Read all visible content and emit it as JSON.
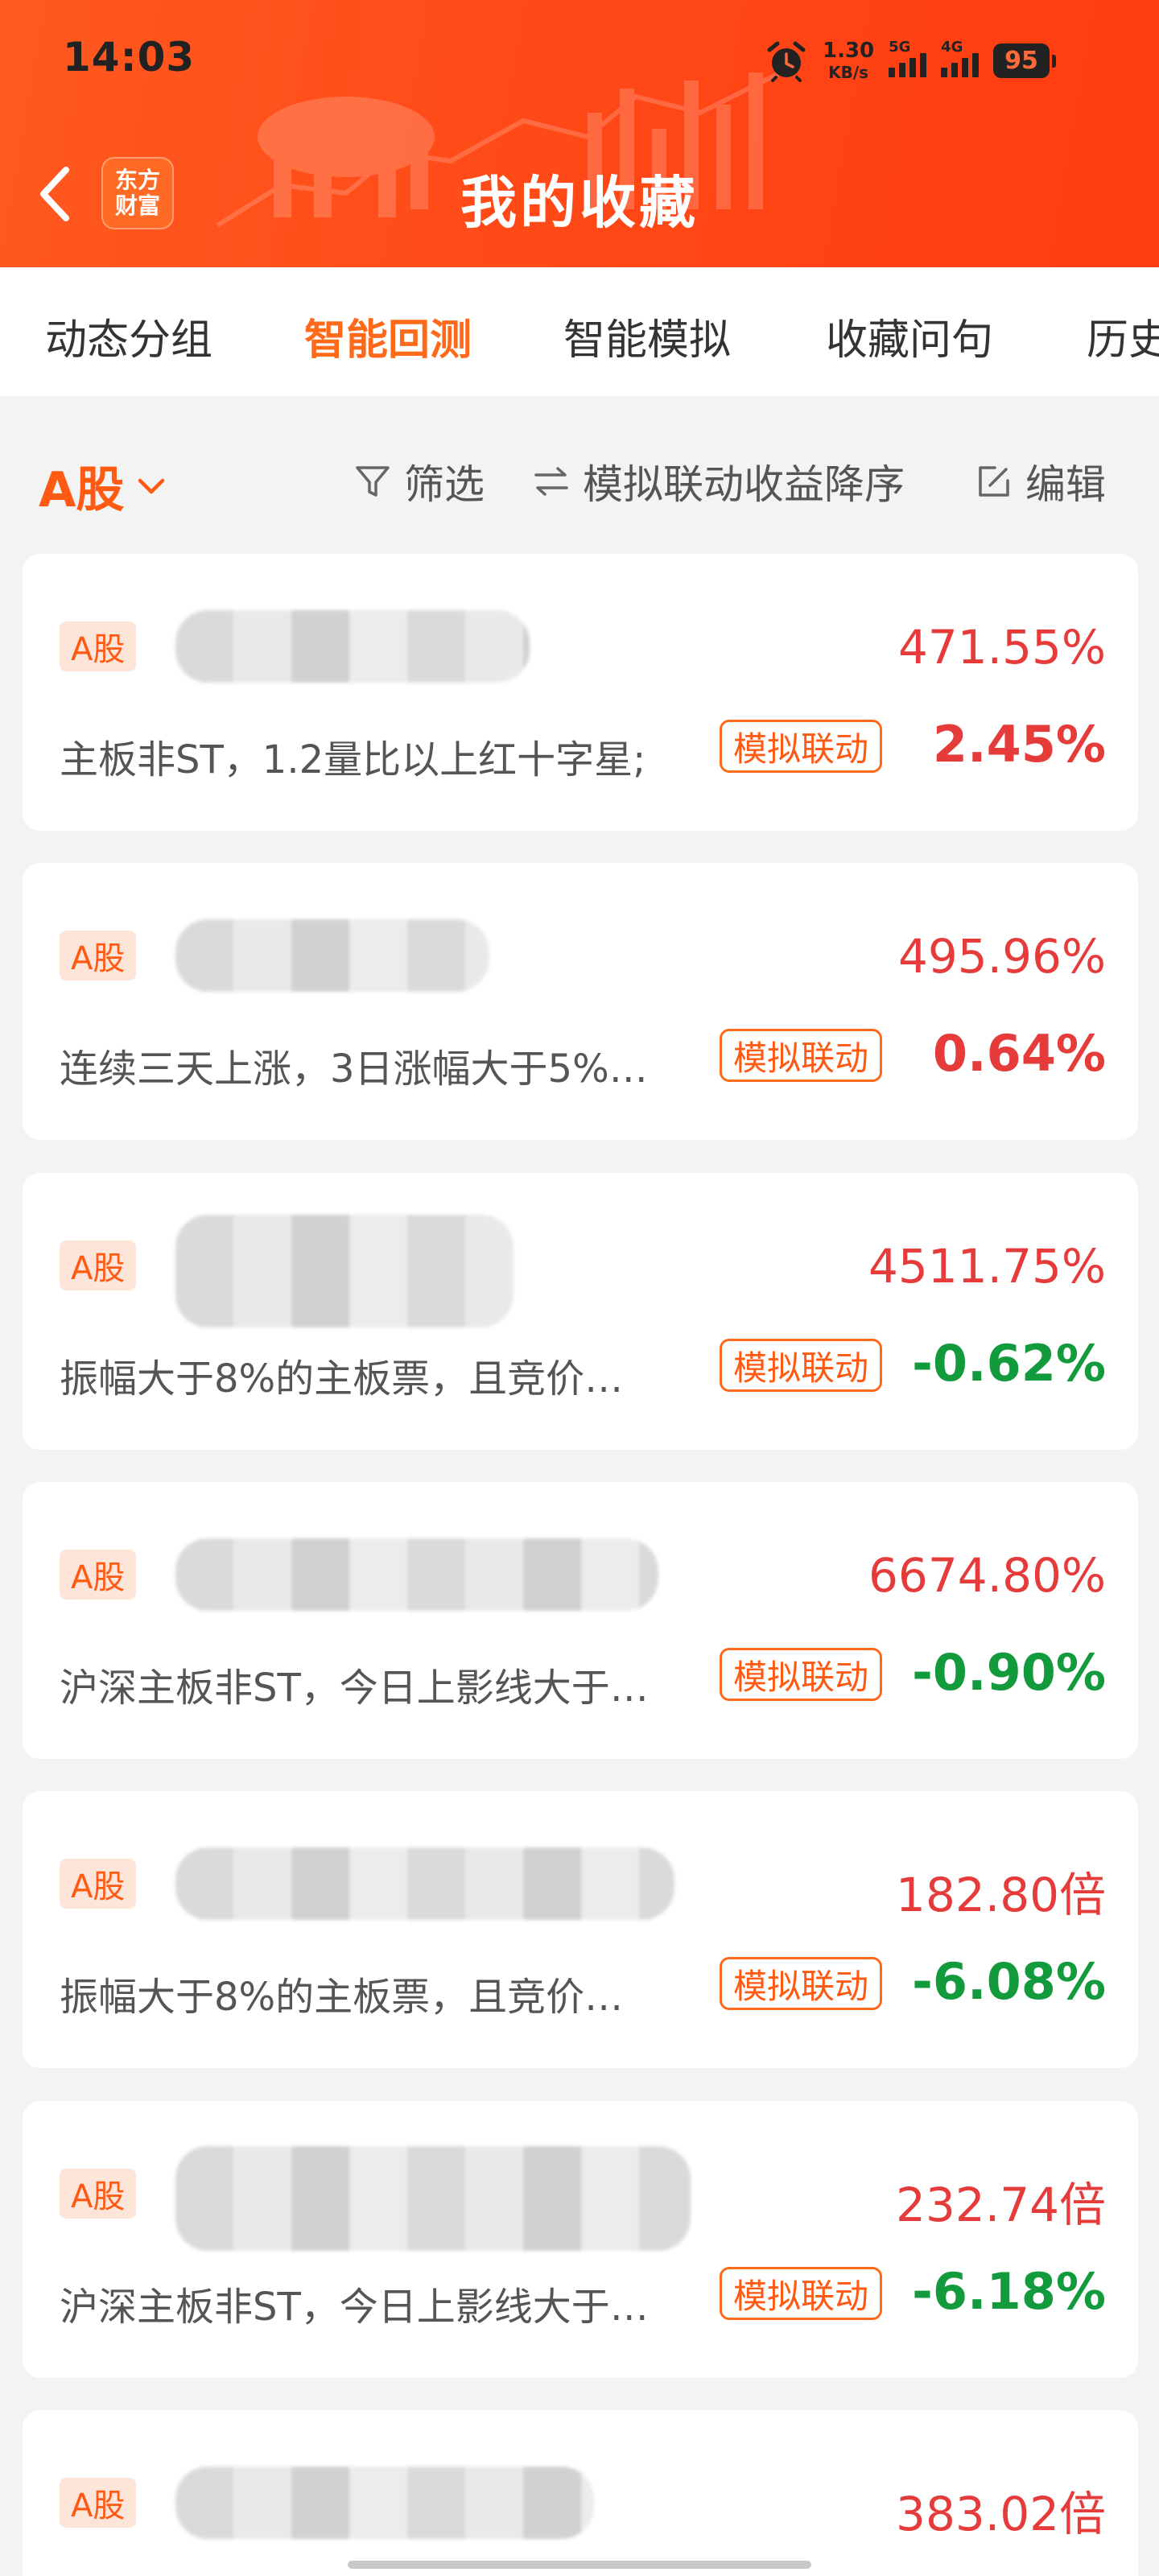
{
  "status_bar": {
    "time": "14:03",
    "net_speed_value": "1.30",
    "net_speed_unit": "KB/s",
    "signal1": "5G",
    "signal2": "4G",
    "battery": "95"
  },
  "header": {
    "logo_line1": "东方",
    "logo_line2": "财富",
    "title": "我的收藏"
  },
  "tabs": [
    {
      "label": "动态分组",
      "active": false
    },
    {
      "label": "智能回测",
      "active": true
    },
    {
      "label": "智能模拟",
      "active": false
    },
    {
      "label": "收藏问句",
      "active": false
    },
    {
      "label": "历史",
      "active": false
    }
  ],
  "filter_bar": {
    "market": "A股",
    "filter_label": "筛选",
    "sort_label": "模拟联动收益降序",
    "edit_label": "编辑"
  },
  "cards": [
    {
      "badge": "A股",
      "value1": "471.55%",
      "description": "主板非ST，1.2量比以上红十字星;",
      "tag": "模拟联动",
      "value2": "2.45%",
      "value2_sign": "positive"
    },
    {
      "badge": "A股",
      "value1": "495.96%",
      "description": "连续三天上涨，3日涨幅大于5%…",
      "tag": "模拟联动",
      "value2": "0.64%",
      "value2_sign": "positive"
    },
    {
      "badge": "A股",
      "value1": "4511.75%",
      "description": "振幅大于8%的主板票，且竞价…",
      "tag": "模拟联动",
      "value2": "-0.62%",
      "value2_sign": "negative"
    },
    {
      "badge": "A股",
      "value1": "6674.80%",
      "description": "沪深主板非ST，今日上影线大于…",
      "tag": "模拟联动",
      "value2": "-0.90%",
      "value2_sign": "negative"
    },
    {
      "badge": "A股",
      "value1": "182.80倍",
      "description": "振幅大于8%的主板票，且竞价…",
      "tag": "模拟联动",
      "value2": "-6.08%",
      "value2_sign": "negative"
    },
    {
      "badge": "A股",
      "value1": "232.74倍",
      "description": "沪深主板非ST，今日上影线大于…",
      "tag": "模拟联动",
      "value2": "-6.18%",
      "value2_sign": "negative"
    },
    {
      "badge": "A股",
      "value1": "383.02倍",
      "description": "",
      "tag": "",
      "value2": "",
      "value2_sign": "positive"
    }
  ]
}
